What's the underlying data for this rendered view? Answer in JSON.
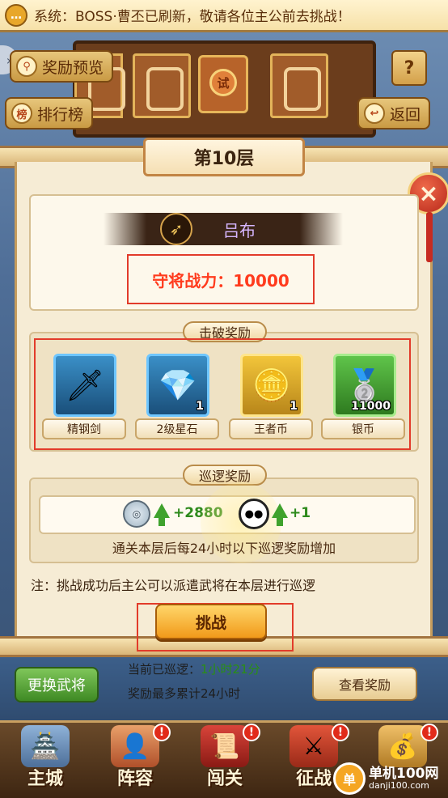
{
  "announcement": {
    "text": "系统：BOSS·曹丕已刷新，敬请各位主公前去挑战！",
    "icon": "speech-bubble-icon"
  },
  "top_buttons": {
    "reward_preview": "奖励预览",
    "ranking": "排行榜",
    "back": "返回",
    "help": "?"
  },
  "temple": {
    "emblem": "试"
  },
  "panel": {
    "floor_title": "第10层",
    "boss_name": "吕布",
    "guard_power": "守将战力：10000",
    "defeat_rewards_label": "击破奖励",
    "rewards": [
      {
        "name": "精钢剑",
        "count": "",
        "icon": "sword-icon"
      },
      {
        "name": "2级星石",
        "count": "1",
        "icon": "star-stone-icon"
      },
      {
        "name": "王者币",
        "count": "1",
        "icon": "king-coin-icon"
      },
      {
        "name": "银币",
        "count": "11000",
        "icon": "silver-coin-icon"
      }
    ],
    "patrol_rewards_label": "巡逻奖励",
    "patrol": {
      "coin_gain": "+2880",
      "panda_gain": "+1"
    },
    "patrol_note": "通关本层后每24小时以下巡逻奖励增加",
    "note": "注：挑战成功后主公可以派遣武将在本层进行巡逻",
    "challenge_button": "挑战"
  },
  "lower": {
    "swap_button": "更换武将",
    "patrol_time_prefix": "当前已巡逻：",
    "patrol_time_value": "1小时21分",
    "max_accumulate": "奖励最多累计24小时",
    "view_rewards_button": "查看奖励"
  },
  "nav": [
    {
      "label": "主城",
      "badge": ""
    },
    {
      "label": "阵容",
      "badge": "!"
    },
    {
      "label": "闯关",
      "badge": "!"
    },
    {
      "label": "征战",
      "badge": "!"
    },
    {
      "label": "",
      "badge": "!"
    }
  ],
  "watermark": {
    "logo": "单",
    "name": "单机100网",
    "url": "danji100.com"
  },
  "colors": {
    "power_red": "#ff3b1d",
    "patrol_green": "#2e8a1c",
    "challenge_orange": "#f19a1a"
  }
}
